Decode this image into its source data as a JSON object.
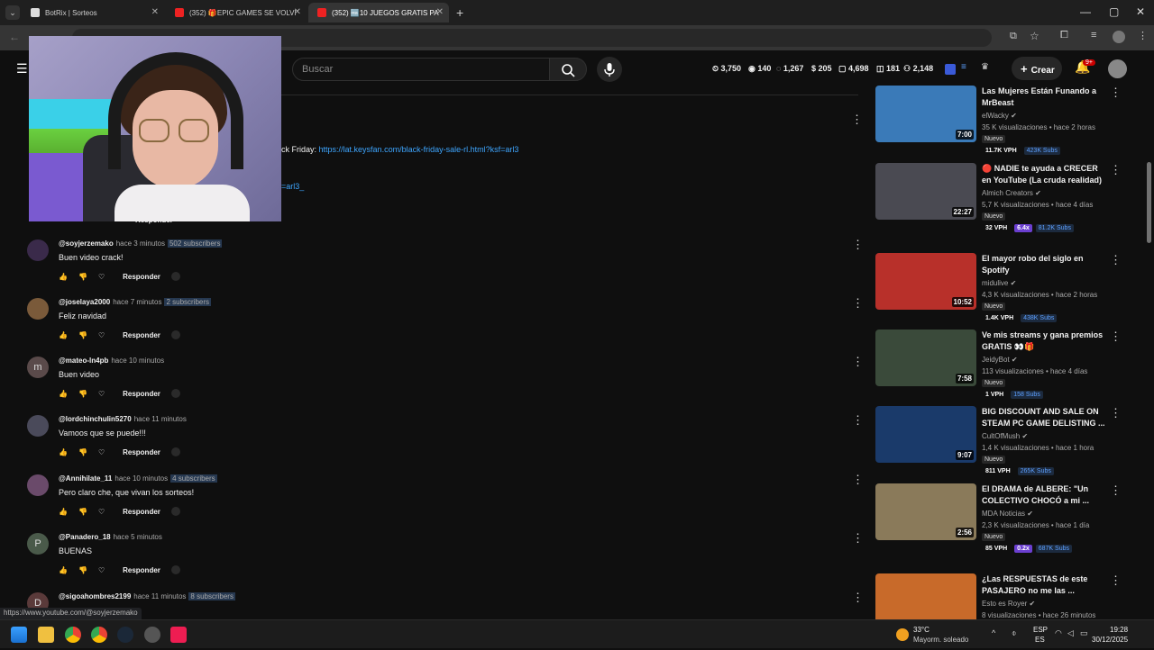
{
  "browser": {
    "tabs": [
      {
        "label": "BotRix | Sorteos"
      },
      {
        "label": "(352) 🎁EPIC GAMES SE VOLVI"
      },
      {
        "label": "(352) 🆓10 JUEGOS GRATIS PA"
      }
    ],
    "new_tab_icon": "plus-icon"
  },
  "youtube": {
    "search_placeholder": "Buscar",
    "stats": [
      "3,750",
      "140",
      "1,267",
      "205",
      "4,698",
      "181",
      "2,148"
    ],
    "create_label": "Crear",
    "notif_badge": "9+"
  },
  "description": {
    "line1_prefix": "ck Friday:",
    "line1_link": "https://lat.keysfan.com/black-friday-sale-rl.html?ksf=arl3",
    "line2_link": "=arl3_"
  },
  "partial_comment": {
    "reply": "Responder"
  },
  "comments": [
    {
      "handle": "@soyjerzemako",
      "time": "hace 3 minutos",
      "subs": "502 subscribers",
      "text": "Buen video crack!",
      "reply": "Responder",
      "avatar_color": "#3a2a4a"
    },
    {
      "handle": "@joselaya2000",
      "time": "hace 7 minutos",
      "subs": "2 subscribers",
      "text": "Feliz navidad",
      "reply": "Responder",
      "avatar_color": "#7a5a3a"
    },
    {
      "handle": "@mateo-ln4pb",
      "time": "hace 10 minutos",
      "subs": "",
      "text": "Buen video",
      "reply": "Responder",
      "avatar_color": "#5a4a4a",
      "initial": "m"
    },
    {
      "handle": "@lordchinchulin5270",
      "time": "hace 11 minutos",
      "subs": "",
      "text": "Vamoos que se puede!!!",
      "reply": "Responder",
      "avatar_color": "#4a4a5a"
    },
    {
      "handle": "@Annihilate_11",
      "time": "hace 10 minutos",
      "subs": "4 subscribers",
      "text": "Pero claro che, que vivan los sorteos!",
      "reply": "Responder",
      "avatar_color": "#6a4a6a"
    },
    {
      "handle": "@Panadero_18",
      "time": "hace 5 minutos",
      "subs": "",
      "text": "BUENAS",
      "reply": "Responder",
      "avatar_color": "#4a5a4a",
      "initial": "P"
    },
    {
      "handle": "@sigoahombres2199",
      "time": "hace 11 minutos",
      "subs": "8 subscribers",
      "text": "",
      "reply": "",
      "avatar_color": "#5a3a3a",
      "initial": "D"
    }
  ],
  "sidebar": [
    {
      "title": "Las Mujeres Están Funando a MrBeast",
      "channel": "elWacky",
      "meta": "35 K visualizaciones • hace 2 horas",
      "new": "Nuevo",
      "vph": "11.7K VPH",
      "mult": "",
      "subs": "423K Subs",
      "duration": "7:00",
      "thumb": "#3a7ab8"
    },
    {
      "title": "🔴 NADIE te ayuda a CRECER en YouTube (La cruda realidad)",
      "channel": "Almich Creators",
      "meta": "5,7 K visualizaciones • hace 4 días",
      "new": "Nuevo",
      "vph": "32 VPH",
      "mult": "6.4x",
      "subs": "81.2K Subs",
      "duration": "22:27",
      "thumb": "#4a4a52"
    },
    {
      "title": "El mayor robo del siglo en Spotify",
      "channel": "midulive",
      "meta": "4,3 K visualizaciones • hace 2 horas",
      "new": "Nuevo",
      "vph": "1.4K VPH",
      "mult": "",
      "subs": "438K Subs",
      "duration": "10:52",
      "thumb": "#b8302a"
    },
    {
      "title": "Ve mis streams y gana premios GRATIS 👀🎁",
      "channel": "JeidyBot",
      "meta": "113 visualizaciones • hace 4 días",
      "new": "Nuevo",
      "vph": "1 VPH",
      "mult": "",
      "subs": "158 Subs",
      "duration": "7:58",
      "thumb": "#3a4a3a"
    },
    {
      "title": "BIG DISCOUNT AND SALE ON STEAM PC GAME DELISTING ...",
      "channel": "CultOfMush",
      "meta": "1,4 K visualizaciones • hace 1 hora",
      "new": "Nuevo",
      "vph": "811 VPH",
      "mult": "",
      "subs": "265K Subs",
      "duration": "9:07",
      "thumb": "#1a3a6a"
    },
    {
      "title": "El DRAMA de ALBERE: \"Un COLECTIVO CHOCÓ a mi ...",
      "channel": "MDA Noticias",
      "meta": "2,3 K visualizaciones • hace 1 día",
      "new": "Nuevo",
      "vph": "85 VPH",
      "mult": "0.2x",
      "subs": "687K Subs",
      "duration": "2:56",
      "thumb": "#8a7a5a"
    },
    {
      "title": "¿Las RESPUESTAS de este PASAJERO no me las ...",
      "channel": "Esto es Royer",
      "meta": "8 visualizaciones • hace 26 minutos",
      "new": "",
      "vph": "",
      "mult": "",
      "subs": "",
      "duration": "",
      "thumb": "#c86a2a"
    }
  ],
  "status_url": "https://www.youtube.com/@soyjerzemako",
  "taskbar": {
    "weather_temp": "33°C",
    "weather_desc": "Mayorm. soleado",
    "lang1": "ESP",
    "lang2": "ES",
    "time": "19:28",
    "date": "30/12/2025"
  }
}
